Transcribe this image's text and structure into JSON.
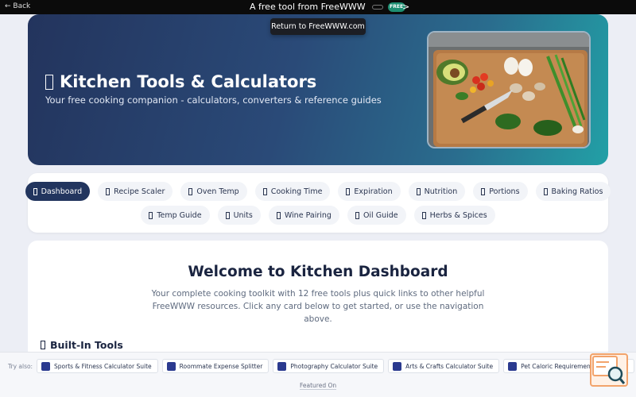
{
  "topbar": {
    "back_label": "← Back",
    "center_text": "A free tool from FreeWWW",
    "logo_badge": "FREE",
    "chevron": ">"
  },
  "tooltip": "Return to FreeWWW.com",
  "hero": {
    "title": "Kitchen Tools & Calculators",
    "subtitle": "Your free cooking companion - calculators, converters & reference guides"
  },
  "nav": {
    "row1": [
      "Dashboard",
      "Recipe Scaler",
      "Oven Temp",
      "Cooking Time",
      "Expiration",
      "Nutrition",
      "Portions",
      "Baking Ratios"
    ],
    "row2": [
      "Temp Guide",
      "Units",
      "Wine Pairing",
      "Oil Guide",
      "Herbs & Spices"
    ],
    "active": "Dashboard"
  },
  "main": {
    "heading": "Welcome to Kitchen Dashboard",
    "intro": "Your complete cooking toolkit with 12 free tools plus quick links to other helpful FreeWWW resources. Click any card below to get started, or use the navigation above.",
    "section_title": "Built-In Tools"
  },
  "footer": {
    "try_also": "Try also:",
    "links": [
      "Sports & Fitness Calculator Suite",
      "Roommate Expense Splitter",
      "Photography Calculator Suite",
      "Arts & Crafts Calculator Suite",
      "Pet Caloric Requirements Calculator"
    ],
    "featured": "Featured On"
  },
  "colors": {
    "hero_start": "#23345d",
    "hero_end": "#22a0a6",
    "active_nav": "#22355e",
    "topbar": "#0b0b0b"
  }
}
